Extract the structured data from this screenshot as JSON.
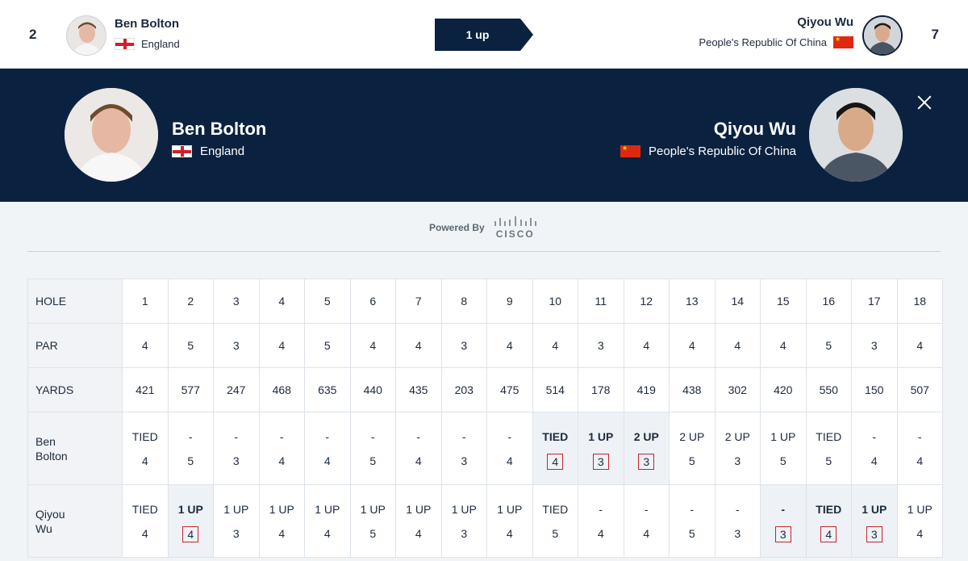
{
  "top_bar": {
    "left_seed": "2",
    "right_seed": "7",
    "match_status": "1 up",
    "player1": {
      "name": "Ben Bolton",
      "country": "England"
    },
    "player2": {
      "name": "Qiyou Wu",
      "country": "People's Republic Of China"
    }
  },
  "head_to_head": {
    "player1": {
      "name": "Ben Bolton",
      "country": "England"
    },
    "player2": {
      "name": "Qiyou Wu",
      "country": "People's Republic Of China"
    }
  },
  "powered_by": {
    "label": "Powered By",
    "brand": "CISCO"
  },
  "scorecard": {
    "headers": {
      "hole": "HOLE",
      "par": "PAR",
      "yards": "YARDS",
      "player1": "Ben Bolton",
      "player2": "Qiyou Wu"
    },
    "holes": [
      "1",
      "2",
      "3",
      "4",
      "5",
      "6",
      "7",
      "8",
      "9",
      "10",
      "11",
      "12",
      "13",
      "14",
      "15",
      "16",
      "17",
      "18"
    ],
    "par": [
      "4",
      "5",
      "3",
      "4",
      "5",
      "4",
      "4",
      "3",
      "4",
      "4",
      "3",
      "4",
      "4",
      "4",
      "4",
      "5",
      "3",
      "4"
    ],
    "yards": [
      "421",
      "577",
      "247",
      "468",
      "635",
      "440",
      "435",
      "203",
      "475",
      "514",
      "178",
      "419",
      "438",
      "302",
      "420",
      "550",
      "150",
      "507"
    ],
    "player1_status": [
      "TIED",
      "-",
      "-",
      "-",
      "-",
      "-",
      "-",
      "-",
      "-",
      "TIED",
      "1 UP",
      "2 UP",
      "2 UP",
      "2 UP",
      "1 UP",
      "TIED",
      "-",
      "-"
    ],
    "player1_scores": [
      "4",
      "5",
      "3",
      "4",
      "4",
      "5",
      "4",
      "3",
      "4",
      "4",
      "3",
      "3",
      "5",
      "3",
      "5",
      "5",
      "4",
      "4"
    ],
    "player1_won": [
      false,
      false,
      false,
      false,
      false,
      false,
      false,
      false,
      false,
      true,
      true,
      true,
      false,
      false,
      false,
      false,
      false,
      false
    ],
    "player2_status": [
      "TIED",
      "1 UP",
      "1 UP",
      "1 UP",
      "1 UP",
      "1 UP",
      "1 UP",
      "1 UP",
      "1 UP",
      "TIED",
      "-",
      "-",
      "-",
      "-",
      "-",
      "TIED",
      "1 UP",
      "1 UP"
    ],
    "player2_scores": [
      "4",
      "4",
      "3",
      "4",
      "4",
      "5",
      "4",
      "3",
      "4",
      "5",
      "4",
      "4",
      "5",
      "3",
      "3",
      "4",
      "3",
      "4"
    ],
    "player2_won": [
      false,
      true,
      false,
      false,
      false,
      false,
      false,
      false,
      false,
      false,
      false,
      false,
      false,
      false,
      true,
      true,
      true,
      false
    ]
  },
  "colors": {
    "navy": "#0a2240",
    "win_box": "#c8232c",
    "win_bg": "#eef2f6"
  }
}
